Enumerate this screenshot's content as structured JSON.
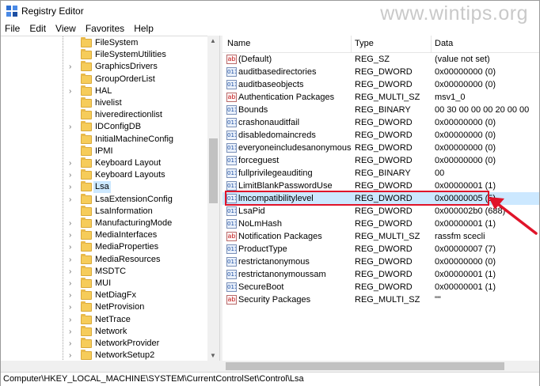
{
  "window": {
    "title": "Registry Editor",
    "watermark": "www.wintips.org"
  },
  "menu": [
    "File",
    "Edit",
    "View",
    "Favorites",
    "Help"
  ],
  "tree": {
    "items": [
      {
        "label": "FileSystem",
        "expandable": false
      },
      {
        "label": "FileSystemUtilities",
        "expandable": false
      },
      {
        "label": "GraphicsDrivers",
        "expandable": true
      },
      {
        "label": "GroupOrderList",
        "expandable": false
      },
      {
        "label": "HAL",
        "expandable": true
      },
      {
        "label": "hivelist",
        "expandable": false
      },
      {
        "label": "hiveredirectionlist",
        "expandable": false
      },
      {
        "label": "IDConfigDB",
        "expandable": true
      },
      {
        "label": "InitialMachineConfig",
        "expandable": false
      },
      {
        "label": "IPMI",
        "expandable": false
      },
      {
        "label": "Keyboard Layout",
        "expandable": true
      },
      {
        "label": "Keyboard Layouts",
        "expandable": true
      },
      {
        "label": "Lsa",
        "expandable": true,
        "selected": true
      },
      {
        "label": "LsaExtensionConfig",
        "expandable": true
      },
      {
        "label": "LsaInformation",
        "expandable": false
      },
      {
        "label": "ManufacturingMode",
        "expandable": true
      },
      {
        "label": "MediaInterfaces",
        "expandable": true
      },
      {
        "label": "MediaProperties",
        "expandable": true
      },
      {
        "label": "MediaResources",
        "expandable": true
      },
      {
        "label": "MSDTC",
        "expandable": true
      },
      {
        "label": "MUI",
        "expandable": true
      },
      {
        "label": "NetDiagFx",
        "expandable": true
      },
      {
        "label": "NetProvision",
        "expandable": true
      },
      {
        "label": "NetTrace",
        "expandable": true
      },
      {
        "label": "Network",
        "expandable": true
      },
      {
        "label": "NetworkProvider",
        "expandable": true
      },
      {
        "label": "NetworkSetup2",
        "expandable": true
      }
    ]
  },
  "values": {
    "columns": {
      "name": "Name",
      "type": "Type",
      "data": "Data"
    },
    "rows": [
      {
        "name": "(Default)",
        "type": "REG_SZ",
        "data": "(value not set)",
        "icon": "string-value-icon"
      },
      {
        "name": "auditbasedirectories",
        "type": "REG_DWORD",
        "data": "0x00000000 (0)",
        "icon": "binary-value-icon"
      },
      {
        "name": "auditbaseobjects",
        "type": "REG_DWORD",
        "data": "0x00000000 (0)",
        "icon": "binary-value-icon"
      },
      {
        "name": "Authentication Packages",
        "type": "REG_MULTI_SZ",
        "data": "msv1_0",
        "icon": "string-value-icon"
      },
      {
        "name": "Bounds",
        "type": "REG_BINARY",
        "data": "00 30 00 00 00 20 00 00",
        "icon": "binary-value-icon"
      },
      {
        "name": "crashonauditfail",
        "type": "REG_DWORD",
        "data": "0x00000000 (0)",
        "icon": "binary-value-icon"
      },
      {
        "name": "disabledomaincreds",
        "type": "REG_DWORD",
        "data": "0x00000000 (0)",
        "icon": "binary-value-icon"
      },
      {
        "name": "everyoneincludesanonymous",
        "type": "REG_DWORD",
        "data": "0x00000000 (0)",
        "icon": "binary-value-icon"
      },
      {
        "name": "forceguest",
        "type": "REG_DWORD",
        "data": "0x00000000 (0)",
        "icon": "binary-value-icon"
      },
      {
        "name": "fullprivilegeauditing",
        "type": "REG_BINARY",
        "data": "00",
        "icon": "binary-value-icon"
      },
      {
        "name": "LimitBlankPasswordUse",
        "type": "REG_DWORD",
        "data": "0x00000001 (1)",
        "icon": "binary-value-icon"
      },
      {
        "name": "lmcompatibilitylevel",
        "type": "REG_DWORD",
        "data": "0x00000005 (5)",
        "icon": "binary-value-icon",
        "highlight": true
      },
      {
        "name": "LsaPid",
        "type": "REG_DWORD",
        "data": "0x000002b0 (688)",
        "icon": "binary-value-icon"
      },
      {
        "name": "NoLmHash",
        "type": "REG_DWORD",
        "data": "0x00000001 (1)",
        "icon": "binary-value-icon"
      },
      {
        "name": "Notification Packages",
        "type": "REG_MULTI_SZ",
        "data": "rassfm scecli",
        "icon": "string-value-icon"
      },
      {
        "name": "ProductType",
        "type": "REG_DWORD",
        "data": "0x00000007 (7)",
        "icon": "binary-value-icon"
      },
      {
        "name": "restrictanonymous",
        "type": "REG_DWORD",
        "data": "0x00000000 (0)",
        "icon": "binary-value-icon"
      },
      {
        "name": "restrictanonymoussam",
        "type": "REG_DWORD",
        "data": "0x00000001 (1)",
        "icon": "binary-value-icon"
      },
      {
        "name": "SecureBoot",
        "type": "REG_DWORD",
        "data": "0x00000001 (1)",
        "icon": "binary-value-icon"
      },
      {
        "name": "Security Packages",
        "type": "REG_MULTI_SZ",
        "data": "\"\"",
        "icon": "string-value-icon"
      }
    ]
  },
  "status": {
    "path": "Computer\\HKEY_LOCAL_MACHINE\\SYSTEM\\CurrentControlSet\\Control\\Lsa"
  },
  "icons": {
    "string_glyph": "ab",
    "binary_glyph": "011",
    "chevron": "›"
  },
  "colors": {
    "highlight": "#cce8ff",
    "annotation": "#e0142a",
    "folder": "#f6cc5a"
  }
}
